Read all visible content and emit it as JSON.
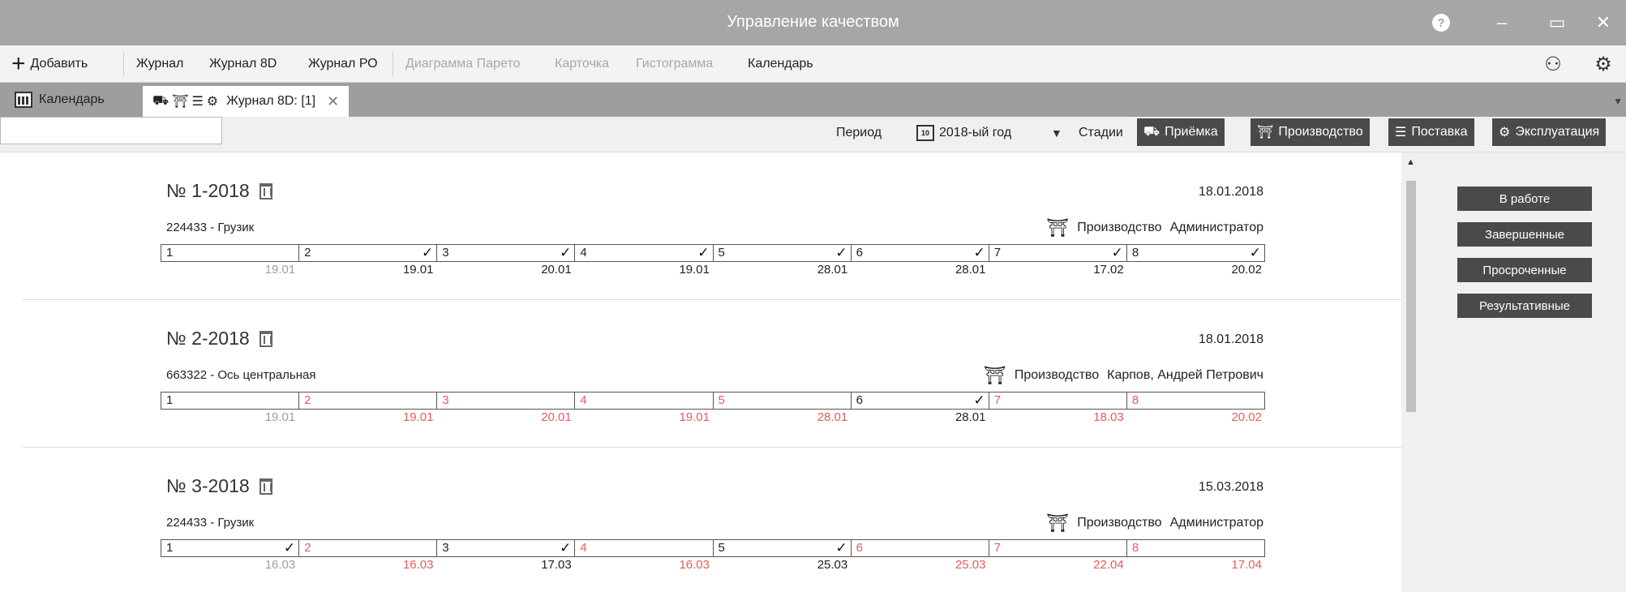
{
  "window": {
    "title": "Управление качеством"
  },
  "toolbar": {
    "add_label": "Добавить",
    "items": [
      {
        "label": "Журнал",
        "enabled": true
      },
      {
        "label": "Журнал 8D",
        "enabled": true
      },
      {
        "label": "Журнал РО",
        "enabled": true
      },
      {
        "label": "Диаграмма Парето",
        "enabled": false
      },
      {
        "label": "Карточка",
        "enabled": false
      },
      {
        "label": "Гистограмма",
        "enabled": false
      },
      {
        "label": "Календарь",
        "enabled": true
      }
    ]
  },
  "tabs": [
    {
      "label": "Календарь",
      "icon": "calendar-icon"
    },
    {
      "label": "Журнал 8D: [1]",
      "icon": "stages-icons"
    }
  ],
  "filters": {
    "search_value": "",
    "period_label": "Период",
    "period_icon_text": "10",
    "period_value": "2018-ый год",
    "stages_label": "Стадии",
    "stages": [
      {
        "label": "Приёмка",
        "icon": "forklift-icon"
      },
      {
        "label": "Производство",
        "icon": "factory-icon"
      },
      {
        "label": "Поставка",
        "icon": "trolley-icon"
      },
      {
        "label": "Эксплуатация",
        "icon": "gears-icon"
      }
    ]
  },
  "status_filters": [
    "В работе",
    "Завершенные",
    "Просроченные",
    "Результативные"
  ],
  "records": [
    {
      "number": "№ 1-2018",
      "date": "18.01.2018",
      "item": "224433 - Грузик",
      "stage": "Производство",
      "owner": "Администратор",
      "steps": [
        {
          "n": "1",
          "status": "normal",
          "checked": false,
          "date": "19.01",
          "date_status": "gray"
        },
        {
          "n": "2",
          "status": "normal",
          "checked": true,
          "date": "19.01",
          "date_status": "normal"
        },
        {
          "n": "3",
          "status": "normal",
          "checked": true,
          "date": "20.01",
          "date_status": "normal"
        },
        {
          "n": "4",
          "status": "normal",
          "checked": true,
          "date": "19.01",
          "date_status": "normal"
        },
        {
          "n": "5",
          "status": "normal",
          "checked": true,
          "date": "28.01",
          "date_status": "normal"
        },
        {
          "n": "6",
          "status": "normal",
          "checked": true,
          "date": "28.01",
          "date_status": "normal"
        },
        {
          "n": "7",
          "status": "normal",
          "checked": true,
          "date": "17.02",
          "date_status": "normal"
        },
        {
          "n": "8",
          "status": "normal",
          "checked": true,
          "date": "20.02",
          "date_status": "normal"
        }
      ]
    },
    {
      "number": "№ 2-2018",
      "date": "18.01.2018",
      "item": "663322 - Ось центральная",
      "stage": "Производство",
      "owner": "Карпов, Андрей Петрович",
      "steps": [
        {
          "n": "1",
          "status": "normal",
          "checked": false,
          "date": "19.01",
          "date_status": "gray"
        },
        {
          "n": "2",
          "status": "red",
          "checked": false,
          "date": "19.01",
          "date_status": "red"
        },
        {
          "n": "3",
          "status": "red",
          "checked": false,
          "date": "20.01",
          "date_status": "red"
        },
        {
          "n": "4",
          "status": "red",
          "checked": false,
          "date": "19.01",
          "date_status": "red"
        },
        {
          "n": "5",
          "status": "red",
          "checked": false,
          "date": "28.01",
          "date_status": "red"
        },
        {
          "n": "6",
          "status": "normal",
          "checked": true,
          "date": "28.01",
          "date_status": "normal"
        },
        {
          "n": "7",
          "status": "red",
          "checked": false,
          "date": "18.03",
          "date_status": "red"
        },
        {
          "n": "8",
          "status": "red",
          "checked": false,
          "date": "20.02",
          "date_status": "red"
        }
      ]
    },
    {
      "number": "№ 3-2018",
      "date": "15.03.2018",
      "item": "224433 - Грузик",
      "stage": "Производство",
      "owner": "Администратор",
      "steps": [
        {
          "n": "1",
          "status": "normal",
          "checked": true,
          "date": "16.03",
          "date_status": "gray"
        },
        {
          "n": "2",
          "status": "red",
          "checked": false,
          "date": "16.03",
          "date_status": "red"
        },
        {
          "n": "3",
          "status": "normal",
          "checked": true,
          "date": "17.03",
          "date_status": "normal"
        },
        {
          "n": "4",
          "status": "red",
          "checked": false,
          "date": "16.03",
          "date_status": "red"
        },
        {
          "n": "5",
          "status": "normal",
          "checked": true,
          "date": "25.03",
          "date_status": "normal"
        },
        {
          "n": "6",
          "status": "red",
          "checked": false,
          "date": "25.03",
          "date_status": "red"
        },
        {
          "n": "7",
          "status": "red",
          "checked": false,
          "date": "22.04",
          "date_status": "red"
        },
        {
          "n": "8",
          "status": "red",
          "checked": false,
          "date": "17.04",
          "date_status": "red"
        }
      ]
    }
  ],
  "colors": {
    "accent_dark": "#4a4a4a",
    "overdue_red": "#e85b5b",
    "muted_gray": "#9e9e9e",
    "titlebar": "#a6a6a6"
  }
}
